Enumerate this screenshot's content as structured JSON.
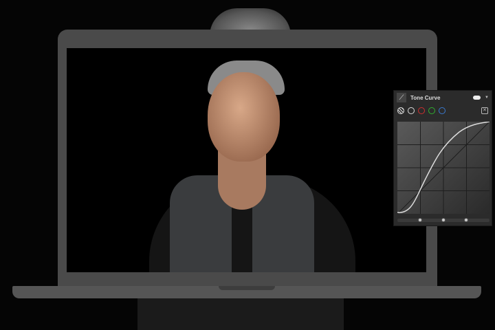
{
  "panel": {
    "title": "Tone Curve",
    "channels": [
      {
        "name": "parametric",
        "color": "#dddddd"
      },
      {
        "name": "rgb",
        "color": "#dddddd"
      },
      {
        "name": "red",
        "color": "#d03030"
      },
      {
        "name": "green",
        "color": "#30b030"
      },
      {
        "name": "blue",
        "color": "#3a7ad0"
      }
    ],
    "toggle_on": true
  }
}
